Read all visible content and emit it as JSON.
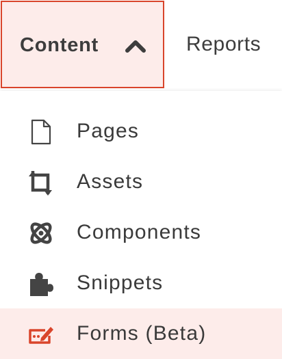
{
  "nav": {
    "content_label": "Content",
    "reports_label": "Reports"
  },
  "menu": {
    "items": [
      {
        "label": "Pages",
        "icon": "page-icon"
      },
      {
        "label": "Assets",
        "icon": "assets-icon"
      },
      {
        "label": "Components",
        "icon": "components-icon"
      },
      {
        "label": "Snippets",
        "icon": "puzzle-icon"
      },
      {
        "label": "Forms (Beta)",
        "icon": "form-edit-icon"
      }
    ],
    "active_index": 4
  },
  "colors": {
    "accent": "#d9452b",
    "active_bg": "#fdecea",
    "text": "#3a3a3a",
    "icon": "#444444"
  }
}
